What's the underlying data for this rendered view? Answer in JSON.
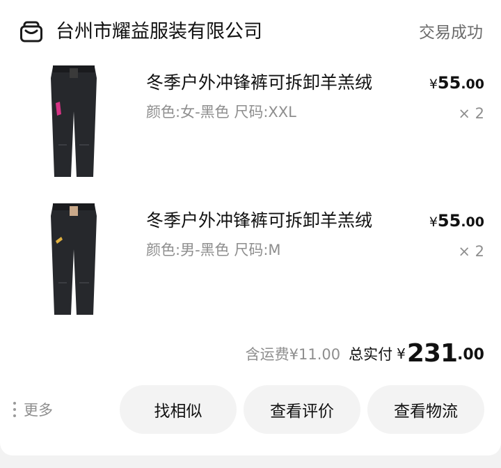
{
  "shop": {
    "name": "台州市耀益服装有限公司",
    "status": "交易成功",
    "icon": "shop-icon"
  },
  "items": [
    {
      "title": "冬季户外冲锋裤可拆卸羊羔绒",
      "spec": "颜色:女-黑色 尺码:XXL",
      "price_symbol": "¥",
      "price_int": "55",
      "price_dec": ".00",
      "qty": "× 2",
      "accent_color": "#d63384"
    },
    {
      "title": "冬季户外冲锋裤可拆卸羊羔绒",
      "spec": "颜色:男-黑色 尺码:M",
      "price_symbol": "¥",
      "price_int": "55",
      "price_dec": ".00",
      "qty": "× 2",
      "accent_color": "#e0b040"
    }
  ],
  "summary": {
    "shipping": "含运费¥11.00",
    "total_label": "总实付",
    "total_symbol": "¥",
    "total_int": "231",
    "total_dec": ".00"
  },
  "footer": {
    "more_label": "更多",
    "buttons": {
      "similar": "找相似",
      "review": "查看评价",
      "logistics": "查看物流"
    }
  }
}
